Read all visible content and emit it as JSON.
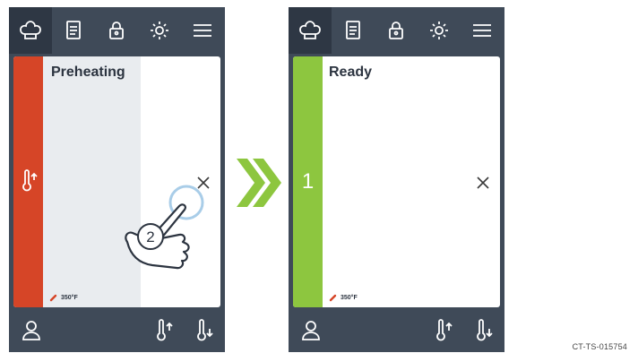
{
  "icons": {
    "tabs": [
      "chef-hat-icon",
      "recipe-book-icon",
      "lock-icon",
      "brightness-icon",
      "menu-icon"
    ],
    "bottom_left": "user-icon",
    "bottom_right": [
      "temperature-up-icon",
      "temperature-exit-icon"
    ]
  },
  "colors": {
    "frame": "#3f4a58",
    "active_tab": "#2e3744",
    "preheat": "#d64527",
    "ready": "#8dc63f",
    "arrow": "#8dc63f"
  },
  "left_screen": {
    "status": "Preheating",
    "temperature": "350°F",
    "preheat_progress": 0.55,
    "gesture_step": "2"
  },
  "right_screen": {
    "status": "Ready",
    "temperature": "350°F",
    "slot_number": "1"
  },
  "caption": "CT-TS-015754"
}
